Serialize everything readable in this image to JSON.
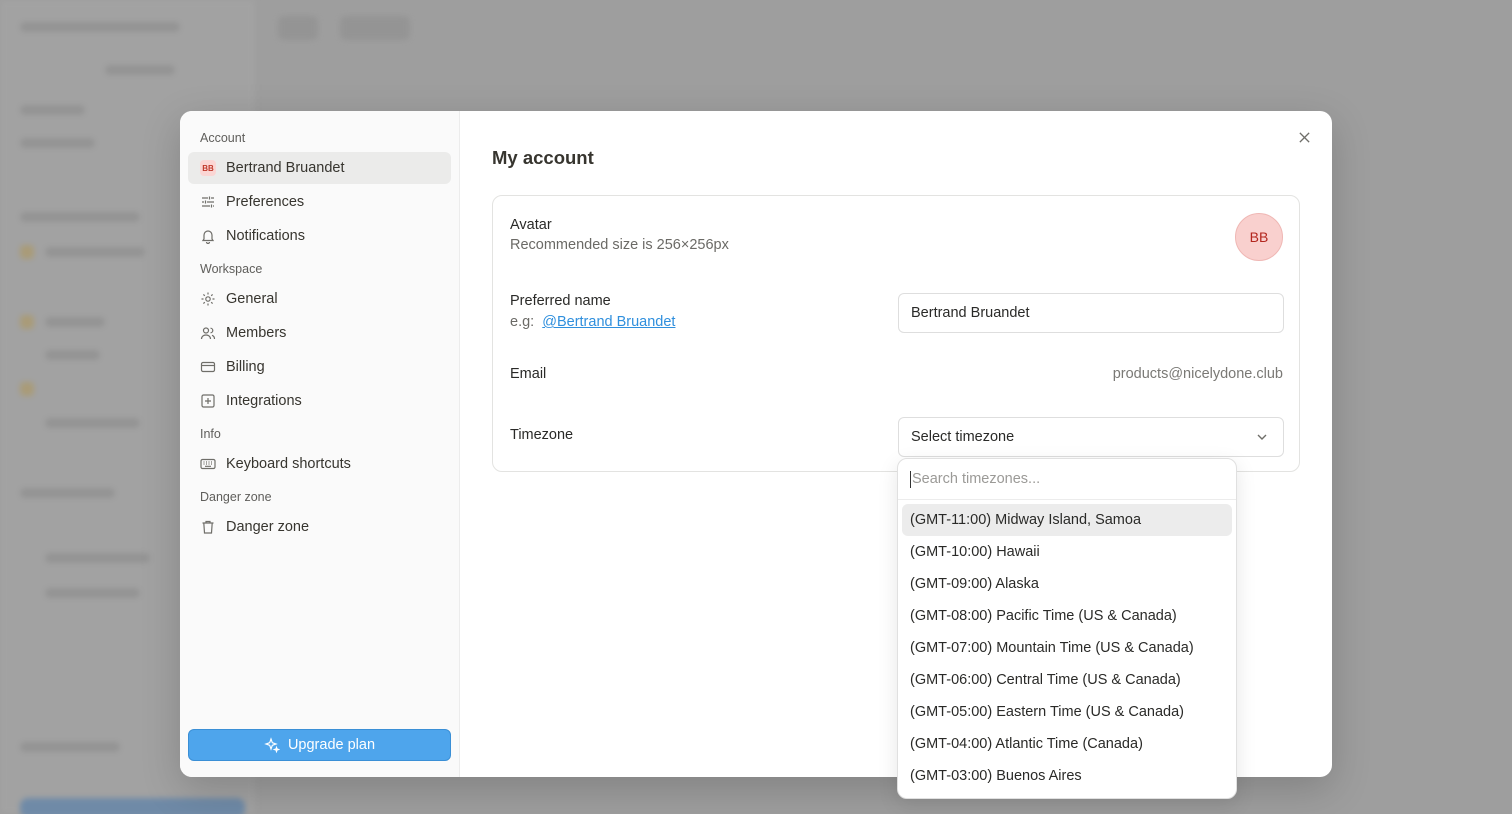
{
  "sidebar": {
    "sections": {
      "account": "Account",
      "workspace": "Workspace",
      "info": "Info",
      "danger": "Danger zone"
    },
    "user": {
      "initials": "BB",
      "name": "Bertrand Bruandet"
    },
    "items": {
      "preferences": "Preferences",
      "notifications": "Notifications",
      "general": "General",
      "members": "Members",
      "billing": "Billing",
      "integrations": "Integrations",
      "shortcuts": "Keyboard shortcuts",
      "danger_zone": "Danger zone"
    },
    "upgrade_label": "Upgrade plan"
  },
  "main": {
    "title": "My account",
    "avatar": {
      "label": "Avatar",
      "hint": "Recommended size is 256×256px",
      "initials": "BB"
    },
    "preferred_name": {
      "label": "Preferred name",
      "example_prefix": "e.g:",
      "example_handle": "@Bertrand Bruandet",
      "value": "Bertrand Bruandet"
    },
    "email": {
      "label": "Email",
      "value": "products@nicelydone.club"
    },
    "timezone": {
      "label": "Timezone",
      "value": "Select timezone"
    }
  },
  "timezone_dropdown": {
    "search_placeholder": "Search timezones...",
    "options": [
      "(GMT-11:00) Midway Island, Samoa",
      "(GMT-10:00) Hawaii",
      "(GMT-09:00) Alaska",
      "(GMT-08:00) Pacific Time (US & Canada)",
      "(GMT-07:00) Mountain Time (US & Canada)",
      "(GMT-06:00) Central Time (US & Canada)",
      "(GMT-05:00) Eastern Time (US & Canada)",
      "(GMT-04:00) Atlantic Time (Canada)",
      "(GMT-03:00) Buenos Aires"
    ]
  },
  "colors": {
    "accent": "#4ea5ec",
    "avatar_bg": "#f9d0ce",
    "avatar_text": "#b3261e",
    "link": "#2f8fdd"
  }
}
